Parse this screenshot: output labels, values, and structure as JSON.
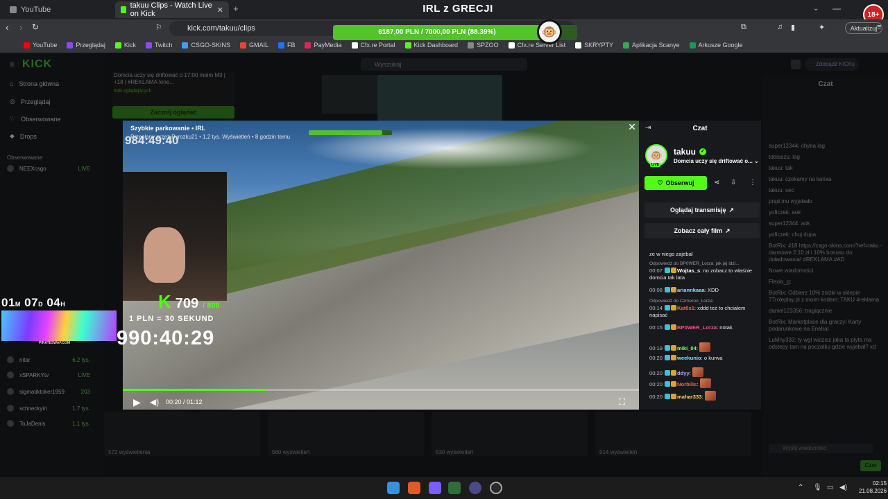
{
  "browser": {
    "tabs": [
      {
        "label": "YouTube",
        "active": false
      },
      {
        "label": "takuu Clips - Watch Live on Kick",
        "active": true
      }
    ],
    "url": "kick.com/takuu/clips",
    "update_label": "Aktualizuj",
    "bookmarks": [
      {
        "label": "YouTube",
        "color": "#ff0000"
      },
      {
        "label": "Przeglądaj",
        "color": "#9146ff"
      },
      {
        "label": "Kick",
        "color": "#53fc18"
      },
      {
        "label": "Twitch",
        "color": "#9146ff"
      },
      {
        "label": "CSGO-SKINS",
        "color": "#3aa0ff"
      },
      {
        "label": "GMAIL",
        "color": "#ea4335"
      },
      {
        "label": "FB",
        "color": "#1877f2"
      },
      {
        "label": "PayMedia",
        "color": "#e0245e"
      },
      {
        "label": "Cfx.re Portal",
        "color": "#ffffff"
      },
      {
        "label": "Kick Dashboard",
        "color": "#53fc18"
      },
      {
        "label": "SPZOO",
        "color": "#888888"
      },
      {
        "label": "Cfx.re Server List",
        "color": "#ffffff"
      },
      {
        "label": "SKRYPTY",
        "color": "#ffffff"
      },
      {
        "label": "Aplikacja Scanye",
        "color": "#34a853"
      },
      {
        "label": "Arkusze Google",
        "color": "#0f9d58"
      }
    ]
  },
  "overlay": {
    "title": "IRL z GRECJI",
    "goal_text": "6187,00 PLN / 7000,00 PLN (88.39%)",
    "goal_progress": 0.8839,
    "age_badge": "18+"
  },
  "kick": {
    "logo": "KICK",
    "search_placeholder": "Wyszukaj",
    "nav": [
      {
        "label": "Strona główna",
        "icon": "home-icon"
      },
      {
        "label": "Przeglądaj",
        "icon": "compass-icon"
      },
      {
        "label": "Obserwowane",
        "icon": "heart-icon"
      },
      {
        "label": "Drops",
        "icon": "drop-icon"
      }
    ],
    "followed_header": "Obserwowane",
    "followed": [
      {
        "name": "NEEXcsgo",
        "status": "LIVE"
      },
      {
        "name": "nitar",
        "status": "6,2 tys."
      },
      {
        "name": "xSPARKYtv",
        "status": "LIVE"
      },
      {
        "name": "sigmatiktoker1959",
        "status": "203"
      },
      {
        "name": "schneckyiri",
        "status": "1,7 tys."
      },
      {
        "name": "ToJaDenis",
        "status": "1,1 tys."
      }
    ],
    "bg_card_title": "Domcia uczy się driftować o 17:00 moim M3 | +18 | #REKLAMA !ene...",
    "bg_card_viewers": "648 oglądających",
    "bg_card_button": "Zacznij oglądać",
    "right_chat_title": "Czat",
    "drops_label": "Zdobądź KICKs",
    "right_chat_lines": [
      "super12344: chyba lag",
      "tobiaszu: lag",
      "takuu: tak",
      "takuu: czekamy na karixa",
      "takuu: sec",
      "prąd mu wyjebało",
      "yoficzek: aok",
      "super12344: aok",
      "yoficzek: chuj dupa",
      "BotRix: #18 https://csgo-skins.com/?ref=taku - darmowe 2.10 zł i 10% bonusu do doładowania! #REKLAMA #AD",
      "Nowe wiadomości",
      "Flexio_g:",
      "BotRix: Odbierz 10% zniżki w sklepie 77roleplay.pl z moim kodem: TAKU #reklama",
      "daniel123356: tragiqcznie",
      "BotRix: Marketplace dla graczy! Karty podarunkowe na Enebal",
      "LuMny333: ty wgl widzisz jaka ta plyta ma odstepy tam na poczatku gdzie wyjebał? xd"
    ],
    "right_chat_input_placeholder": "Wyślij wiadomość",
    "right_chat_send": "Czat",
    "clip_views": [
      "572 wyświetlenia",
      "560 wyświetleń",
      "530 wyświetleń",
      "514 wyświetleń"
    ]
  },
  "modal": {
    "clip_title": "Szybkie parkowanie • IRL",
    "clip_meta": "Przesłany przez Pyrozku21 • 1,2 tys. Wyświetleń • 8 godzin temu",
    "video_time": "00:20 / 01:12",
    "progress": 0.2778,
    "overlay_timer_top": "984:49:40",
    "left_timer": {
      "d1": "01",
      "u1": "M",
      "d2": "07",
      "u2": "D",
      "d3": "04",
      "u3": "H"
    },
    "pirate_label": "PIRATESWAP.COM",
    "k_count": "709",
    "k_total": "/ 800",
    "rate": "1 PLN = 30 SEKUND",
    "big_timer": "990:40:29",
    "chat_title": "Czat",
    "streamer": "takuu",
    "stream_title": "Domcia uczy się driftować o...",
    "live": "LIVE",
    "follow_label": "Obserwuj",
    "watch_stream_label": "Oglądaj transmisję",
    "watch_full_label": "Zobacz cały film",
    "messages": [
      {
        "type": "plain",
        "text": "ze w niego zajebał"
      },
      {
        "type": "reply",
        "text": "Odpowiedź do BP0WER_Lorza: jak jej idzi..."
      },
      {
        "time": "00:07",
        "user": "Wojtas_s",
        "color": "#ffffff",
        "text": "no zobacz to właśnie domcia tak lata"
      },
      {
        "time": "00:08",
        "user": "ariannkaaa",
        "color": "#7fe0ff",
        "text": "XDD"
      },
      {
        "type": "reply",
        "text": "Odpowiedź do Czmeroo_Lorza:"
      },
      {
        "time": "00:14",
        "user": "Kat0s1",
        "color": "#ff5c5c",
        "text": "xddd też to chciałem napisać"
      },
      {
        "time": "00:15",
        "user": "BP0WER_Lorza",
        "color": "#ff4b8b",
        "text": "notak"
      },
      {
        "time": "00:19",
        "user": "miki_04",
        "color": "#7dff7d",
        "text": ""
      },
      {
        "time": "00:20",
        "user": "weekunio",
        "color": "#7fe0ff",
        "text": "o kurwa"
      },
      {
        "time": "00:20",
        "user": "ddyy",
        "color": "#b5a3ff",
        "text": ""
      },
      {
        "time": "00:20",
        "user": "Norbilis",
        "color": "#ff5c5c",
        "text": ""
      },
      {
        "time": "00:20",
        "user": "mahar333",
        "color": "#ffd36b",
        "text": ""
      }
    ]
  },
  "taskbar": {
    "time": "02:15",
    "date": "21.08.2026"
  }
}
